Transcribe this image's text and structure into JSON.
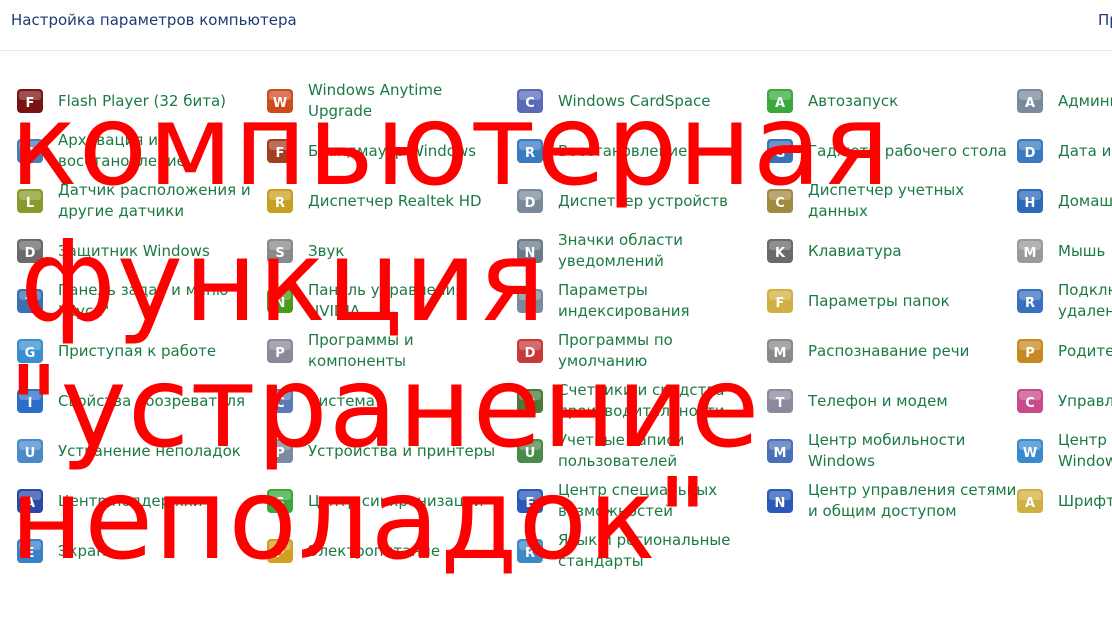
{
  "header": {
    "title": "Настройка параметров компьютера",
    "right_text": "Пр"
  },
  "columns": [
    [
      {
        "label": "Flash Player (32 бита)",
        "icon": "flash-icon"
      },
      {
        "label": "Архивация и\nвосстановление",
        "icon": "backup-icon"
      },
      {
        "label": "Датчик расположения и\nдругие датчики",
        "icon": "location-sensor-icon"
      },
      {
        "label": "Защитник Windows",
        "icon": "defender-icon"
      },
      {
        "label": "Панель задач и меню\n\"Пуск\"",
        "icon": "taskbar-icon"
      },
      {
        "label": "Приступая к работе",
        "icon": "getting-started-icon"
      },
      {
        "label": "Свойства обозревателя",
        "icon": "internet-options-icon"
      },
      {
        "label": "Устранение неполадок",
        "icon": "troubleshooting-icon"
      },
      {
        "label": "Центр поддержки",
        "icon": "action-center-icon"
      },
      {
        "label": "Экран",
        "icon": "display-icon"
      }
    ],
    [
      {
        "label": "Windows Anytime\nUpgrade",
        "icon": "anytime-upgrade-icon"
      },
      {
        "label": "Брандмауэр Windows",
        "icon": "firewall-icon"
      },
      {
        "label": "Диспетчер Realtek HD",
        "icon": "realtek-icon"
      },
      {
        "label": "Звук",
        "icon": "sound-icon"
      },
      {
        "label": "Панель управления\nNVIDIA",
        "icon": "nvidia-icon"
      },
      {
        "label": "Программы и\nкомпоненты",
        "icon": "programs-icon"
      },
      {
        "label": "Система",
        "icon": "system-icon"
      },
      {
        "label": "Устройства и принтеры",
        "icon": "printers-icon"
      },
      {
        "label": "Центр синхронизации",
        "icon": "sync-center-icon"
      },
      {
        "label": "Электропитание",
        "icon": "power-icon"
      }
    ],
    [
      {
        "label": "Windows CardSpace",
        "icon": "cardspace-icon"
      },
      {
        "label": "Восстановление",
        "icon": "recovery-icon"
      },
      {
        "label": "Диспетчер устройств",
        "icon": "device-manager-icon"
      },
      {
        "label": "Значки области\nуведомлений",
        "icon": "notification-icons-icon"
      },
      {
        "label": "Параметры\nиндексирования",
        "icon": "indexing-icon"
      },
      {
        "label": "Программы по\nумолчанию",
        "icon": "default-programs-icon"
      },
      {
        "label": "Счетчики и средства\nпроизводительности",
        "icon": "performance-icon"
      },
      {
        "label": "Учетные записи\nпользователей",
        "icon": "user-accounts-icon"
      },
      {
        "label": "Центр специальных\nвозможностей",
        "icon": "ease-of-access-icon"
      },
      {
        "label": "Язык и региональные\nстандарты",
        "icon": "region-icon"
      }
    ],
    [
      {
        "label": "Автозапуск",
        "icon": "autoplay-icon"
      },
      {
        "label": "Гаджеты рабочего стола",
        "icon": "gadgets-icon"
      },
      {
        "label": "Диспетчер учетных\nданных",
        "icon": "credential-manager-icon"
      },
      {
        "label": "Клавиатура",
        "icon": "keyboard-icon"
      },
      {
        "label": "Параметры папок",
        "icon": "folder-options-icon"
      },
      {
        "label": "Распознавание речи",
        "icon": "speech-icon"
      },
      {
        "label": "Телефон и модем",
        "icon": "phone-modem-icon"
      },
      {
        "label": "Центр мобильности\nWindows",
        "icon": "mobility-center-icon"
      },
      {
        "label": "Центр управления сетями\nи общим доступом",
        "icon": "network-center-icon"
      }
    ],
    [
      {
        "label": "Админи",
        "icon": "admin-tools-icon"
      },
      {
        "label": "Дата и в",
        "icon": "date-time-icon"
      },
      {
        "label": "Домашн",
        "icon": "homegroup-icon"
      },
      {
        "label": "Мышь",
        "icon": "mouse-icon"
      },
      {
        "label": "Подклю\nудаленн",
        "icon": "remote-connection-icon"
      },
      {
        "label": "Родител",
        "icon": "parental-controls-icon"
      },
      {
        "label": "Управле",
        "icon": "color-management-icon"
      },
      {
        "label": "Центр о\nWindow",
        "icon": "windows-update-icon"
      },
      {
        "label": "Шрифты",
        "icon": "fonts-icon"
      }
    ]
  ],
  "overlay": {
    "lines": [
      "компьютерная",
      "функция",
      "\"устранение",
      "неполадок\""
    ],
    "color": "#ff0000"
  },
  "colors": {
    "link": "#1b7a43",
    "header": "#1e3a78"
  }
}
